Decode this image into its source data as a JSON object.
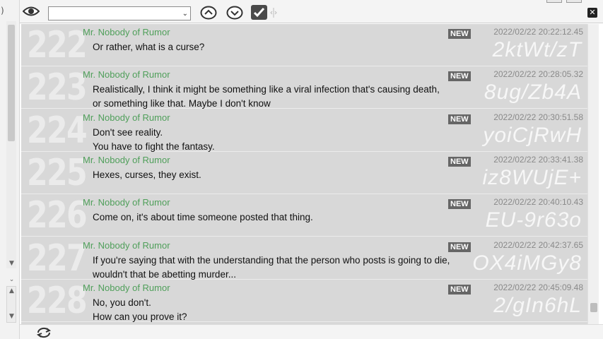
{
  "left_gutter": {
    "paren": ")"
  },
  "toolbar": {
    "filter_value": "",
    "eye_icon": "eye-icon",
    "up_icon": "chevron-up-circle-icon",
    "down_icon": "chevron-down-circle-icon",
    "check_icon": "checkmark-icon",
    "close_icon": "close-icon",
    "close_glyph": "✕"
  },
  "colors": {
    "author": "#4f9f5a",
    "badge": "#666666",
    "list_background": "#d8d8d8"
  },
  "posts": [
    {
      "number": "222",
      "author": "Mr. Nobody of Rumor",
      "badge": "NEW",
      "date": "2022/02/22  20:22:12.45",
      "id": "2ktWt/zT",
      "lines": [
        "Or rather, what is a curse?"
      ]
    },
    {
      "number": "223",
      "author": "Mr. Nobody of Rumor",
      "badge": "NEW",
      "date": "2022/02/22  20:28:05.32",
      "id": "8ug/Zb4A",
      "lines": [
        "Realistically, I think it might be something like a viral infection that's causing death,",
        "or something like that. Maybe I don't know"
      ]
    },
    {
      "number": "224",
      "author": "Mr. Nobody of Rumor",
      "badge": "NEW",
      "date": "2022/02/22  20:30:51.58",
      "id": "yoiCjRwH",
      "lines": [
        "Don't see reality.",
        "You have to fight the fantasy."
      ]
    },
    {
      "number": "225",
      "author": "Mr. Nobody of Rumor",
      "badge": "NEW",
      "date": "2022/02/22  20:33:41.38",
      "id": "iz8WUjE+",
      "lines": [
        "Hexes, curses, they exist."
      ]
    },
    {
      "number": "226",
      "author": "Mr. Nobody of Rumor",
      "badge": "NEW",
      "date": "2022/02/22  20:40:10.43",
      "id": "EU-9r63o",
      "lines": [
        "Come on, it's about time someone posted that thing."
      ]
    },
    {
      "number": "227",
      "author": "Mr. Nobody of Rumor",
      "badge": "NEW",
      "date": "2022/02/22  20:42:37.65",
      "id": "OX4iMGy8",
      "lines": [
        "If you're saying that with the understanding that the person who posts is going to die,",
        "wouldn't that be abetting murder..."
      ]
    },
    {
      "number": "228",
      "author": "Mr. Nobody of Rumor",
      "badge": "NEW",
      "date": "2022/02/22  20:45:09.48",
      "id": "2/gIn6hL",
      "lines": [
        "No, you don't.",
        "How can you prove it?"
      ]
    }
  ],
  "bottom_bar": {
    "reload_icon": "reload-icon"
  }
}
